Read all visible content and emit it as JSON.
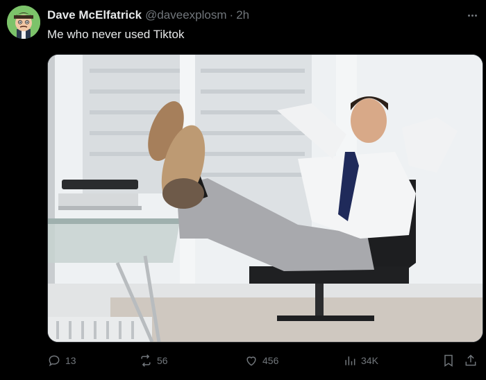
{
  "post": {
    "author_name": "Dave McElfatrick",
    "handle": "@daveexplosm",
    "separator": "·",
    "time": "2h",
    "text": "Me who never used Tiktok"
  },
  "actions": {
    "replies": "13",
    "reposts": "56",
    "likes": "456",
    "views": "34K"
  },
  "icons": {
    "avatar": "cartoon-avatar",
    "more": "more-icon",
    "reply": "reply-icon",
    "repost": "repost-icon",
    "like": "heart-icon",
    "views": "analytics-icon",
    "bookmark": "bookmark-icon",
    "share": "share-icon"
  },
  "colors": {
    "background": "#000000",
    "primary_text": "#e7e9ea",
    "secondary_text": "#71767b",
    "border": "#2f3336"
  }
}
